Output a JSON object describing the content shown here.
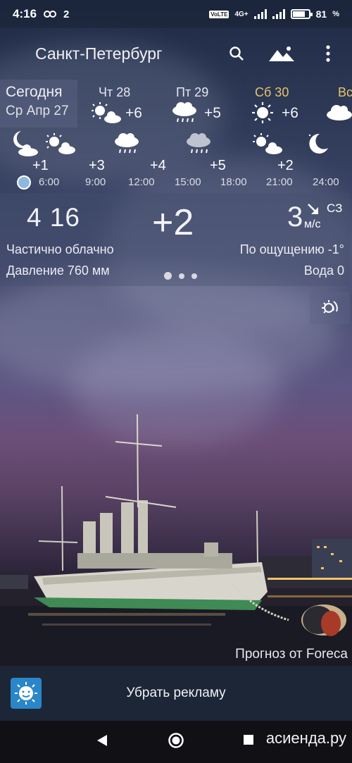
{
  "status": {
    "time": "4:16",
    "notif_count": "2",
    "battery": "81",
    "network": "4G+",
    "volte": "VoLTE"
  },
  "toolbar": {
    "city": "Санкт-Петербург"
  },
  "days": [
    {
      "name": "Сегодня",
      "date": "Ср Апр 27"
    },
    {
      "name": "Чт 28",
      "temp": "+6",
      "icon": "partly-cloudy-icon"
    },
    {
      "name": "Пт 29",
      "temp": "+5",
      "icon": "rain-icon"
    },
    {
      "name": "Сб 30",
      "temp": "+6",
      "icon": "sun-icon",
      "color": "#e8c36a"
    },
    {
      "name": "Вс",
      "icon": "cloud-icon",
      "color": "#e8c36a"
    }
  ],
  "hourly": [
    {
      "time": "6:00",
      "temp": "+1",
      "icon": "moon-cloud-icon"
    },
    {
      "time": "9:00",
      "temp": "+3",
      "icon": "partly-cloudy-icon"
    },
    {
      "time": "12:00",
      "temp": "+4",
      "icon": "rain-icon"
    },
    {
      "time": "15:00",
      "temp": "+5",
      "icon": "rain-icon"
    },
    {
      "time": "18:00",
      "temp": "+2",
      "icon": "partly-cloudy-icon"
    },
    {
      "time": "21:00",
      "temp": "+2",
      "icon": "moon-icon"
    },
    {
      "time": "24:00",
      "temp": "",
      "icon": ""
    }
  ],
  "current": {
    "time": "4 16",
    "temp": "+2",
    "wind_speed": "3",
    "wind_dir": "СЗ",
    "wind_unit": "м/с",
    "condition": "Частично облачно",
    "feels_like": "По ощущению -1°",
    "pressure": "Давление 760 мм",
    "water": "Вода 0"
  },
  "credit": "Прогноз от Foreca",
  "ad": {
    "label": "Убрать рекламу"
  },
  "watermark": "асиенда.ру"
}
